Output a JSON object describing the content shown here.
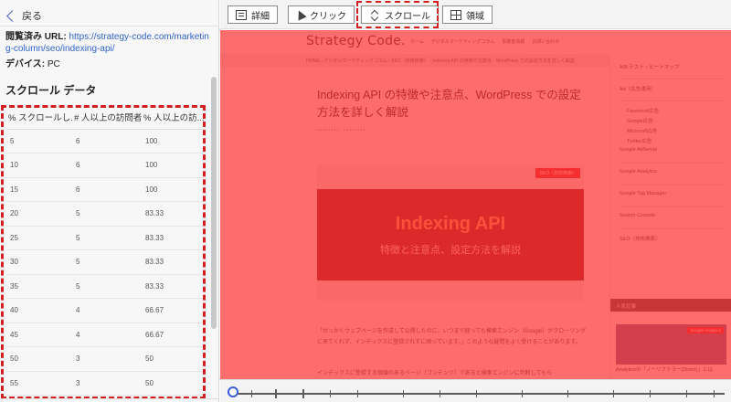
{
  "nav": {
    "back_label": "戻る"
  },
  "info": {
    "url_label": "閲覧済み URL:",
    "url": "https://strategy-code.com/marketing-column/seo/indexing-api/",
    "device_label": "デバイス:",
    "device": "PC"
  },
  "scroll_section": {
    "title": "スクロール データ",
    "columns": [
      "% スクロールし...",
      "# 人以上の訪問者",
      "% 人以上の訪..."
    ],
    "rows": [
      [
        "5",
        "6",
        "100"
      ],
      [
        "10",
        "6",
        "100"
      ],
      [
        "15",
        "6",
        "100"
      ],
      [
        "20",
        "5",
        "83.33"
      ],
      [
        "25",
        "5",
        "83.33"
      ],
      [
        "30",
        "5",
        "83.33"
      ],
      [
        "35",
        "5",
        "83.33"
      ],
      [
        "40",
        "4",
        "66.67"
      ],
      [
        "45",
        "4",
        "66.67"
      ],
      [
        "50",
        "3",
        "50"
      ],
      [
        "55",
        "3",
        "50"
      ]
    ]
  },
  "toolbar": {
    "detail_label": "詳細",
    "click_label": "クリック",
    "scroll_label": "スクロール",
    "area_label": "領域",
    "active": "スクロール"
  },
  "preview": {
    "logo": "Strategy Code.",
    "global_nav": [
      "ホーム",
      "デジタルマーケティングコラム",
      "事業者情報",
      "お問い合わせ"
    ],
    "breadcrumb": "HOME › デジタルマーケティングコラム › SEO（技術検索） › Indexing API の特徴や注意点、WordPress での設定方法を詳しく解説",
    "article_title": "Indexing API の特徴や注意点、WordPress での設定方法を詳しく解説",
    "category_tag": "SEO（技術検索）",
    "eyecatch_title": "Indexing API",
    "eyecatch_subtitle": "特徴と注意点、設定方法を解説",
    "paragraph_1": "「せっかくウェブページを作成して公開したのに、いつまで経っても検索エンジン（Google）がクローリングに来てくれず、インデックスに登録されずに困っています。」このような疑問をよく受けることがあります。",
    "paragraph_2": "インデックスに登録する価値のあるページ（コンテンツ）であると検索エンジンに判断してもら",
    "sidebar_items": [
      {
        "label": "A/B テスト・ヒートマップ",
        "sub": false
      },
      {
        "label": "Ad（広告運用）",
        "sub": false
      },
      {
        "label": "Facebook広告",
        "sub": true
      },
      {
        "label": "Google広告",
        "sub": true
      },
      {
        "label": "Microsoft広告",
        "sub": true
      },
      {
        "label": "Twitter広告",
        "sub": true
      },
      {
        "label": "Google AdSense",
        "sub": false
      },
      {
        "label": "Google Analytics",
        "sub": false
      },
      {
        "label": "Google Tag Manager",
        "sub": false
      },
      {
        "label": "Search Console",
        "sub": false
      },
      {
        "label": "SEO（技術検索）",
        "sub": false
      }
    ],
    "popular_header": "人気記事",
    "popular_badge": "Google Analytics",
    "popular_caption": "Analyticsの「ノーリファラー(Direct)」とは"
  },
  "colors": {
    "accent": "#d21f1f",
    "overlay": "rgba(255,45,45,0.70)",
    "link": "#2f64c8",
    "knob": "#3b5fd9"
  },
  "timeline": {
    "position_fraction": 0
  }
}
